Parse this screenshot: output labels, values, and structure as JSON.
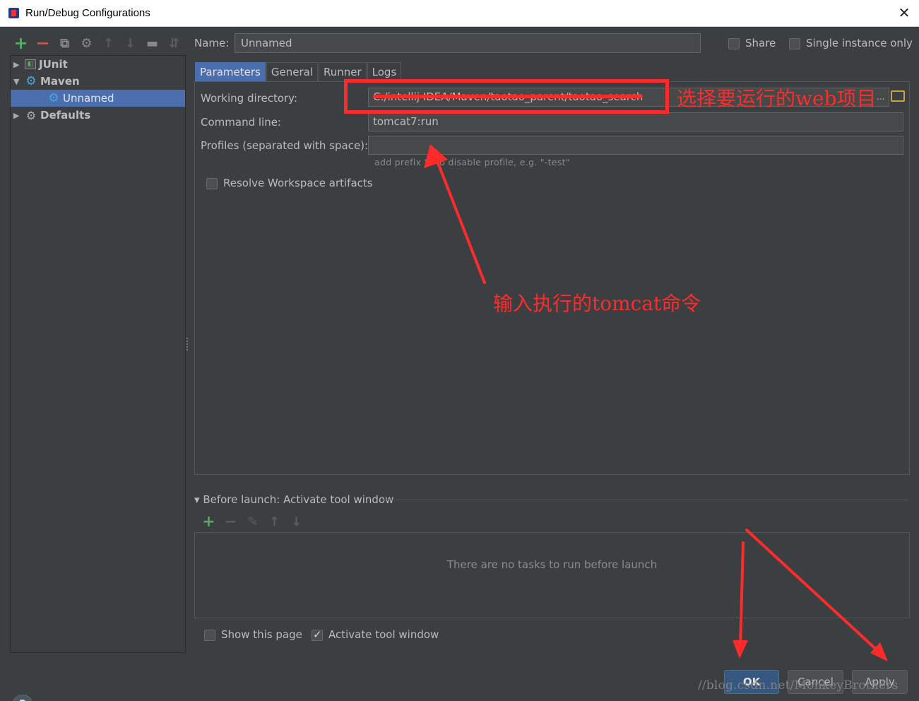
{
  "window": {
    "title": "Run/Debug Configurations",
    "close_icon": "✕"
  },
  "toolbar": {
    "add": "+",
    "remove": "−",
    "copy": "⧉",
    "edit_defaults": "⚙",
    "move_up": "↑",
    "move_down": "↓",
    "folder": "▬",
    "sort": "⇵"
  },
  "tree": {
    "items": [
      {
        "label": "JUnit",
        "icon": "junit-icon"
      },
      {
        "label": "Maven",
        "icon": "maven-gear-icon"
      },
      {
        "label": "Unnamed",
        "icon": "maven-config-icon"
      },
      {
        "label": "Defaults",
        "icon": "defaults-icon"
      }
    ]
  },
  "name": {
    "label": "Name:",
    "value": "Unnamed"
  },
  "options": {
    "share": "Share",
    "single_instance": "Single instance only"
  },
  "tabs": [
    "Parameters",
    "General",
    "Runner",
    "Logs"
  ],
  "parameters": {
    "working_directory_label": "Working directory:",
    "working_directory_value": "C:/intellij IDEA/Maven/taotao_parent/taotao_search",
    "command_line_label": "Command line:",
    "command_line_value": "tomcat7:run",
    "profiles_label": "Profiles (separated with space):",
    "profiles_value": "",
    "profiles_hint": "add prefix '-' to disable profile, e.g. \"-test\"",
    "resolve_workspace_label": "Resolve Workspace artifacts",
    "ellipsis": "..."
  },
  "before_launch": {
    "header": "Before launch: Activate tool window",
    "empty_text": "There are no tasks to run before launch",
    "toolbar": {
      "add": "+",
      "remove": "−",
      "edit": "✎",
      "up": "↑",
      "down": "↓"
    }
  },
  "footer": {
    "show_this_page": "Show this page",
    "activate_tool_window": "Activate tool window",
    "ok": "OK",
    "cancel": "Cancel",
    "apply": "Apply",
    "help": "?"
  },
  "annotations": {
    "select_project": "选择要运行的web项目",
    "input_command": "输入执行的tomcat命令",
    "color": "#ff2b2b"
  },
  "watermark": "//blog.csdn.net/MonkeyBrothers"
}
